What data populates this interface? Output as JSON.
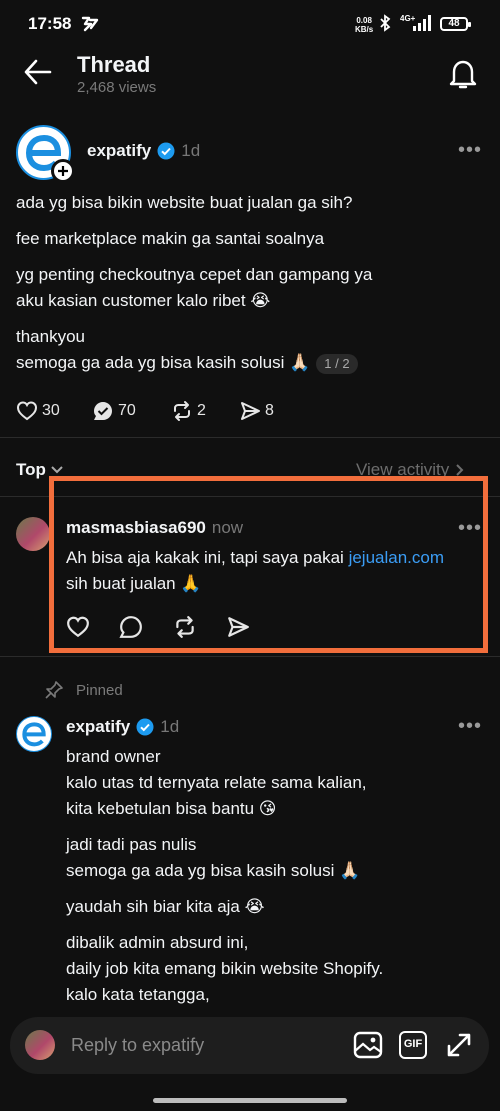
{
  "status_bar": {
    "time": "17:58",
    "speed_value": "0.08",
    "speed_unit": "KB/s",
    "network": "4G+",
    "battery": "48"
  },
  "header": {
    "title": "Thread",
    "views": "2,468 views"
  },
  "post": {
    "author": "expatify",
    "time": "1d",
    "paragraphs": [
      "ada yg bisa bikin website buat jualan ga sih?",
      "fee marketplace makin ga santai soalnya",
      "yg penting checkoutnya cepet dan gampang ya",
      "aku kasian customer kalo ribet 😭",
      "thankyou",
      "semoga ga ada yg bisa kasih solusi 🙏🏻"
    ],
    "pager": "1 / 2",
    "likes": "30",
    "replies": "70",
    "reposts": "2",
    "shares": "8"
  },
  "sort": {
    "label": "Top",
    "activity_link": "View activity"
  },
  "reply": {
    "author": "masmasbiasa690",
    "time": "now",
    "text_before": "Ah bisa aja kakak ini, tapi saya pakai ",
    "link": "jejualan.com",
    "text_after": "sih buat jualan 🙏"
  },
  "pinned": {
    "label": "Pinned",
    "author": "expatify",
    "time": "1d",
    "lines": [
      "brand owner",
      "kalo utas td ternyata relate sama kalian,",
      "kita kebetulan bisa bantu 😘",
      "jadi tadi pas nulis",
      "semoga ga ada yg bisa kasih solusi 🙏🏻",
      "yaudah sih biar kita aja 😭",
      "dibalik admin absurd ini,",
      "daily job kita emang bikin website Shopify.",
      "kalo kata tetangga,"
    ]
  },
  "composer": {
    "placeholder": "Reply to expatify",
    "gif_label": "GIF"
  },
  "colors": {
    "background": "#101010",
    "verified": "#1d9bf0",
    "link": "#3b9df5",
    "highlight": "#f26e3c",
    "brand": "#1b8fe0"
  }
}
